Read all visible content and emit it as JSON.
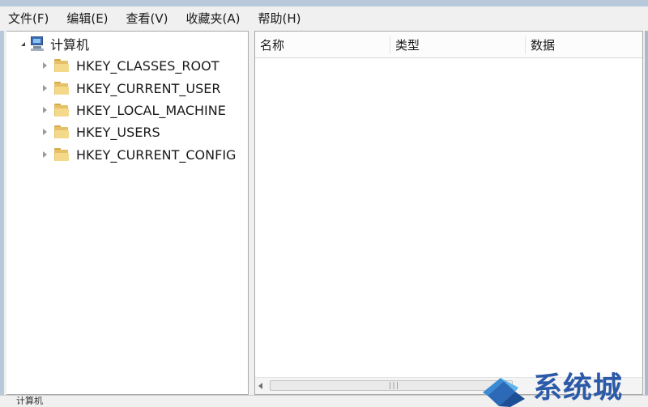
{
  "menu": [
    {
      "label": "文件(F)"
    },
    {
      "label": "编辑(E)"
    },
    {
      "label": "查看(V)"
    },
    {
      "label": "收藏夹(A)"
    },
    {
      "label": "帮助(H)"
    }
  ],
  "tree": {
    "root": {
      "label": "计算机",
      "icon": "computer-icon",
      "expanded": true
    },
    "children": [
      {
        "label": "HKEY_CLASSES_ROOT",
        "icon": "folder-icon",
        "expanded": false
      },
      {
        "label": "HKEY_CURRENT_USER",
        "icon": "folder-icon",
        "expanded": false
      },
      {
        "label": "HKEY_LOCAL_MACHINE",
        "icon": "folder-icon",
        "expanded": false
      },
      {
        "label": "HKEY_USERS",
        "icon": "folder-icon",
        "expanded": false
      },
      {
        "label": "HKEY_CURRENT_CONFIG",
        "icon": "folder-icon",
        "expanded": false
      }
    ]
  },
  "list": {
    "columns": [
      {
        "label": "名称"
      },
      {
        "label": "类型"
      },
      {
        "label": "数据"
      }
    ]
  },
  "statusbar": {
    "text": "计算机"
  },
  "watermark": {
    "text": "系统城"
  },
  "colors": {
    "accent": "#2c5aa8",
    "folder": "#e6c066",
    "frame": "#b9c9dc"
  }
}
